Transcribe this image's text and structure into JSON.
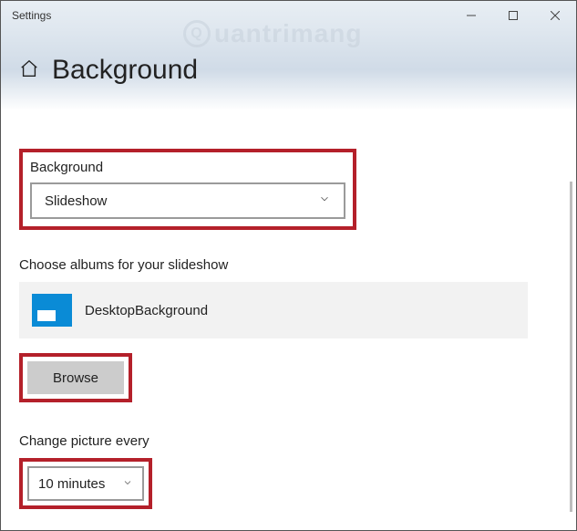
{
  "window": {
    "title": "Settings"
  },
  "header": {
    "page_title": "Background"
  },
  "watermark": {
    "text": "uantrimang"
  },
  "background_section": {
    "label": "Background",
    "selected": "Slideshow"
  },
  "albums_section": {
    "label": "Choose albums for your slideshow",
    "album_name": "DesktopBackground",
    "browse_label": "Browse"
  },
  "change_section": {
    "label": "Change picture every",
    "selected": "10 minutes"
  }
}
